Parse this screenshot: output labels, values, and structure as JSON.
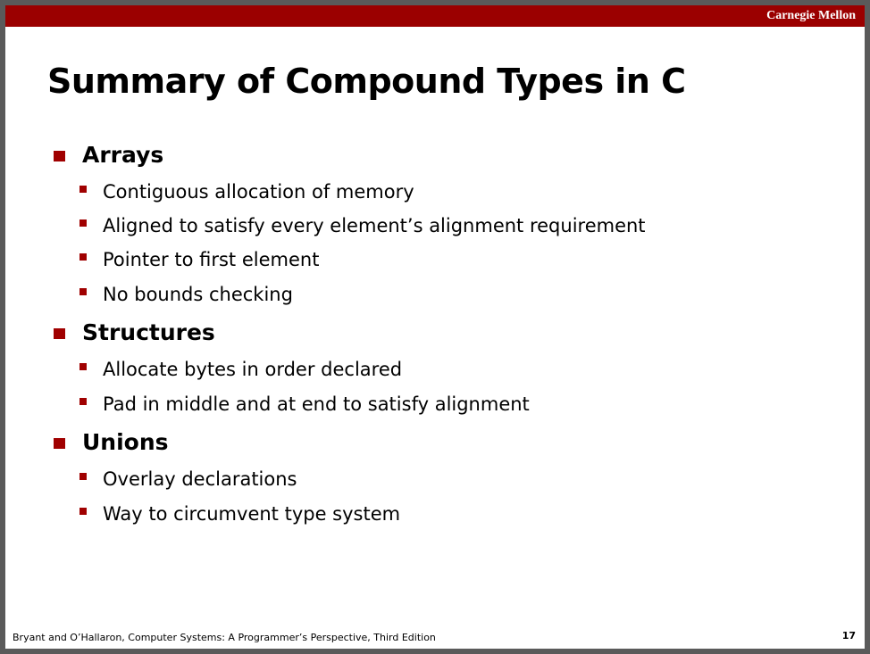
{
  "header": {
    "brand": "Carnegie Mellon"
  },
  "slide": {
    "title": "Summary of Compound Types in C",
    "sections": [
      {
        "title": "Arrays",
        "items": [
          "Contiguous allocation of memory",
          "Aligned to satisfy every element’s alignment requirement",
          "Pointer to first element",
          "No bounds checking"
        ]
      },
      {
        "title": "Structures",
        "items": [
          "Allocate bytes in order declared",
          "Pad in middle and at end to satisfy alignment"
        ]
      },
      {
        "title": "Unions",
        "items": [
          "Overlay declarations",
          "Way to circumvent type system"
        ]
      }
    ]
  },
  "footer": {
    "citation": "Bryant and O’Hallaron, Computer Systems: A Programmer’s Perspective, Third Edition",
    "page_number": "17"
  },
  "colors": {
    "brand_red": "#9b0000",
    "bullet_red": "#a00000"
  }
}
